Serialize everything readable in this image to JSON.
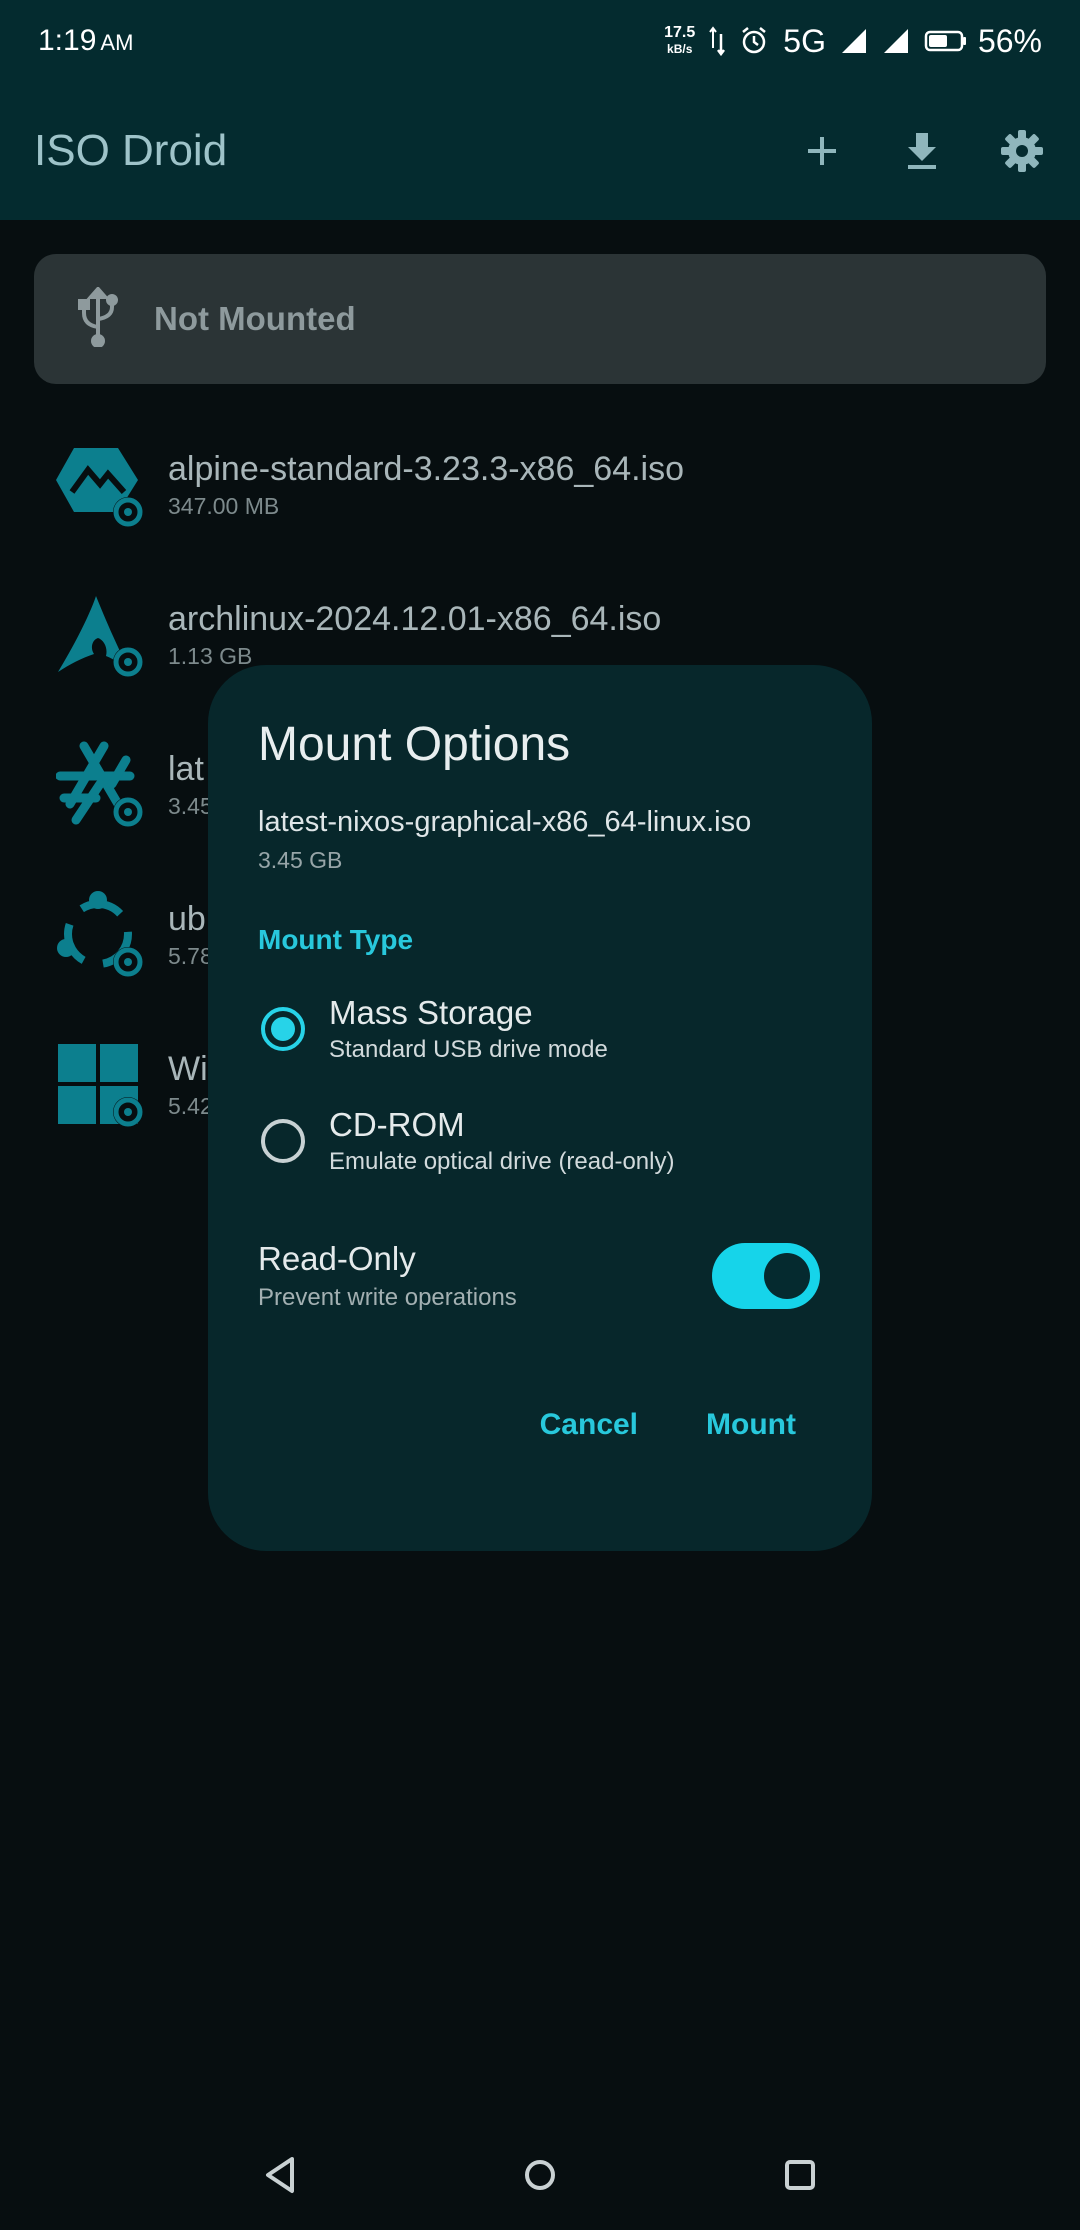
{
  "status_bar": {
    "time": "1:19",
    "time_suffix": "AM",
    "net_speed": "17.5",
    "net_unit": "kB/s",
    "network": "5G",
    "battery": "56%"
  },
  "app_bar": {
    "title": "ISO Droid",
    "icons": [
      "add-icon",
      "download-icon",
      "gear-icon"
    ]
  },
  "mount_status": {
    "icon": "usb-icon",
    "label": "Not Mounted"
  },
  "iso_list": [
    {
      "name": "alpine-standard-3.23.3-x86_64.iso",
      "size": "347.00 MB",
      "icon": "alpine-icon"
    },
    {
      "name": "archlinux-2024.12.01-x86_64.iso",
      "size": "1.13 GB",
      "icon": "arch-icon"
    },
    {
      "name": "lat",
      "size": "3.45",
      "icon": "nixos-icon"
    },
    {
      "name": "ub",
      "size": "5.78",
      "icon": "ubuntu-icon"
    },
    {
      "name": "Wi",
      "size": "5.42",
      "icon": "windows-icon"
    }
  ],
  "dialog": {
    "title": "Mount Options",
    "file_name": "latest-nixos-graphical-x86_64-linux.iso",
    "file_size": "3.45 GB",
    "section_label": "Mount Type",
    "options": [
      {
        "title": "Mass Storage",
        "subtitle": "Standard USB drive mode",
        "selected": true
      },
      {
        "title": "CD-ROM",
        "subtitle": "Emulate optical drive (read-only)",
        "selected": false
      }
    ],
    "read_only": {
      "title": "Read-Only",
      "subtitle": "Prevent write operations",
      "enabled": true
    },
    "cancel_label": "Cancel",
    "mount_label": "Mount"
  },
  "colors": {
    "accent": "#28c8dc",
    "app_bar": "#042b2f",
    "dialog_bg": "#07272b",
    "background": "#070e10"
  }
}
